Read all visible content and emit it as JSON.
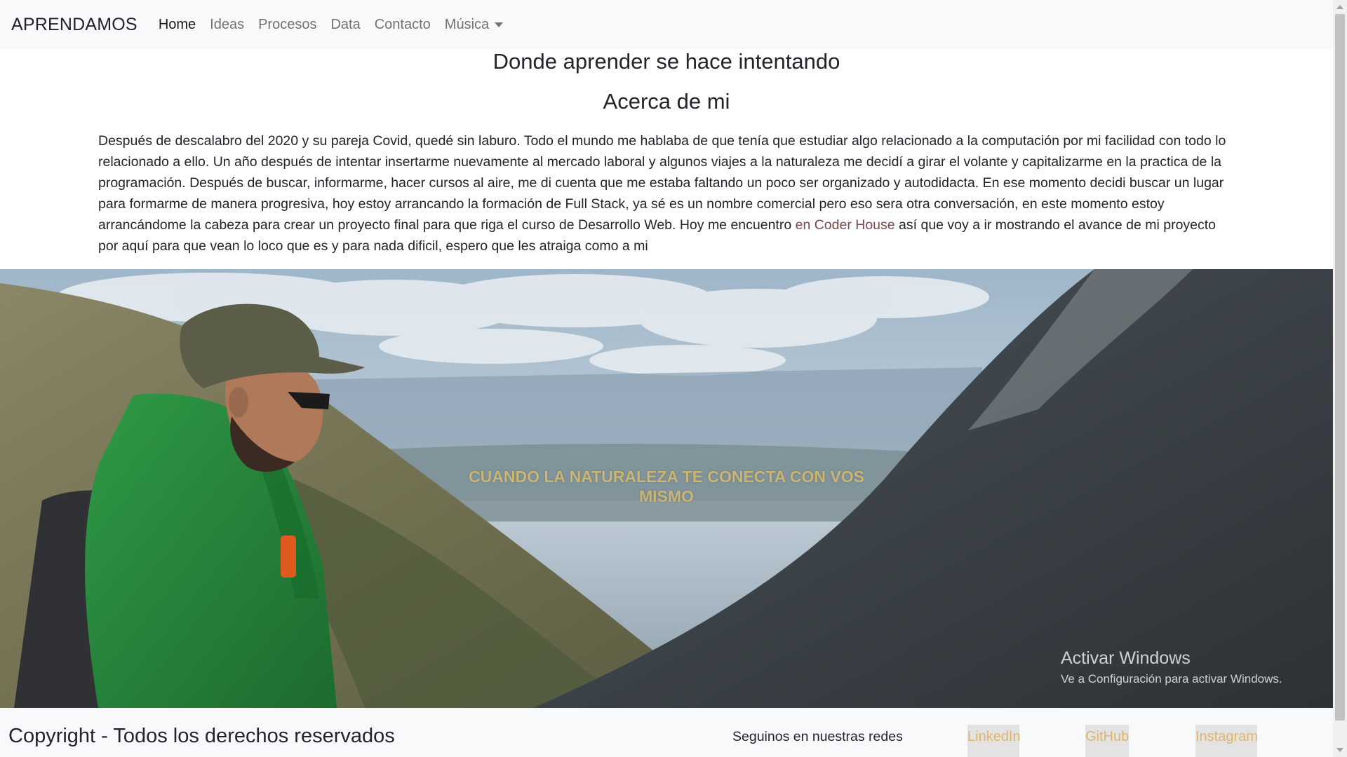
{
  "navbar": {
    "brand": "APRENDAMOS",
    "links": [
      {
        "label": "Home"
      },
      {
        "label": "Ideas"
      },
      {
        "label": "Procesos"
      },
      {
        "label": "Data"
      },
      {
        "label": "Contacto"
      },
      {
        "label": "Música"
      }
    ]
  },
  "main": {
    "title": "Donde aprender se hace intentando",
    "subtitle": "Acerca de mi",
    "paragraph_before_link": "Después de descalabro del 2020 y su pareja Covid, quedé sin laburo. Todo el mundo me hablaba de que tenía que estudiar algo relacionado a la computación por mi facilidad con todo lo relacionado a ello. Un año después de intentar insertarme nuevamente al mercado laboral y algunos viajes a la naturaleza me decidí a girar el volante y capitalizarme en la practica de la programación. Después de buscar, informarme, hacer cursos al aire, me di cuenta que me estaba faltando un poco ser organizado y autodidacta. En ese momento decidi buscar un lugar para formarme de manera progresiva, hoy estoy arrancando la formación de Full Stack, ya sé es un nombre comercial pero eso sera otra conversación, en este momento estoy arrancándome la cabeza para crear un proyecto final para que riga el curso de Desarrollo Web. Hoy me encuentro",
    "link_text": "en Coder House",
    "paragraph_after_link": "así que voy a ir mostrando el avance de mi proyecto por aquí para que vean lo loco que es y para nada dificil, espero que les atraiga como a mi"
  },
  "hero": {
    "caption": "CUANDO LA NATURALEZA TE CONECTA CON VOS MISMO"
  },
  "watermark": {
    "title": "Activar Windows",
    "subtitle": "Ve a Configuración para activar Windows."
  },
  "footer": {
    "copyright": "Copyright - Todos los derechos reservados",
    "social_label": "Seguinos en nuestras redes",
    "social_links": [
      {
        "label": "LinkedIn"
      },
      {
        "label": "GitHub"
      },
      {
        "label": "Instagram"
      }
    ]
  },
  "colors": {
    "navbar_bg": "#f8f9fa",
    "link_accent": "#7a4a4a",
    "caption": "#c9b574",
    "social_link": "#e0b56a"
  }
}
